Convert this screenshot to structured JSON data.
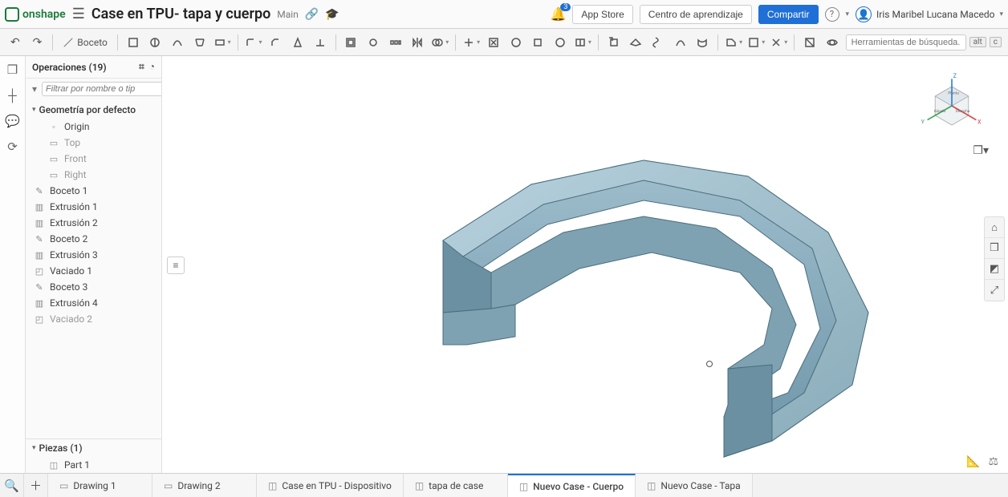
{
  "brand": "onshape",
  "doc_title": "Case en TPU- tapa y cuerpo",
  "branch": "Main",
  "notifications": "3",
  "topbar": {
    "app_store": "App Store",
    "learning": "Centro de aprendizaje",
    "share": "Compartir",
    "user": "Iris Maribel Lucana Macedo"
  },
  "sketch_label": "Boceto",
  "search_placeholder": "Herramientas de búsqueda...",
  "kbd_alt": "alt",
  "kbd_c": "c",
  "features": {
    "title": "Operaciones (19)",
    "filter_placeholder": "Filtrar por nombre o tip",
    "default_geom": "Geometría por defecto",
    "items_geo": [
      {
        "label": "Origin",
        "icon": "◦"
      },
      {
        "label": "Top",
        "icon": "▭",
        "dim": true
      },
      {
        "label": "Front",
        "icon": "▭",
        "dim": true
      },
      {
        "label": "Right",
        "icon": "▭",
        "dim": true
      }
    ],
    "items": [
      {
        "label": "Boceto 1",
        "icon": "✎"
      },
      {
        "label": "Extrusión 1",
        "icon": "▥"
      },
      {
        "label": "Extrusión 2",
        "icon": "▥"
      },
      {
        "label": "Boceto 2",
        "icon": "✎"
      },
      {
        "label": "Extrusión 3",
        "icon": "▥"
      },
      {
        "label": "Vaciado 1",
        "icon": "◰"
      },
      {
        "label": "Boceto 3",
        "icon": "✎"
      },
      {
        "label": "Extrusión 4",
        "icon": "▥"
      },
      {
        "label": "Vaciado 2",
        "icon": "◰",
        "dim": true
      }
    ],
    "parts_title": "Piezas (1)",
    "part1": "Part 1"
  },
  "triad": {
    "x": "X",
    "y": "Y",
    "z": "Z",
    "top": "Planta",
    "right": "Derecha",
    "front": "Alzado"
  },
  "tabs": [
    {
      "label": "Drawing 1",
      "icon": "▭"
    },
    {
      "label": "Drawing 2",
      "icon": "▭"
    },
    {
      "label": "Case en TPU - Dispositivo",
      "icon": "◫"
    },
    {
      "label": "tapa de case",
      "icon": "◫"
    },
    {
      "label": "Nuevo Case - Cuerpo",
      "icon": "◫",
      "active": true
    },
    {
      "label": "Nuevo Case - Tapa",
      "icon": "◫"
    }
  ]
}
